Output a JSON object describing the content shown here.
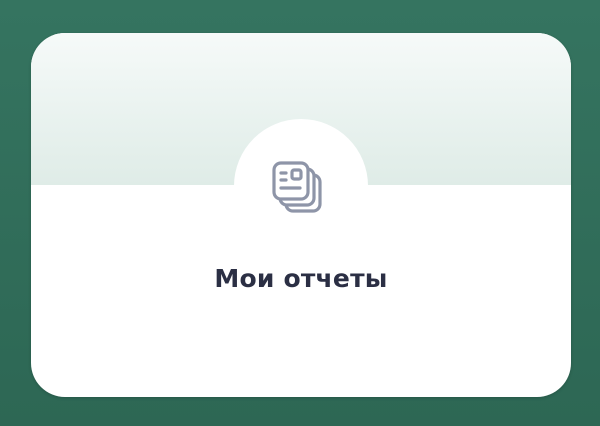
{
  "card": {
    "title": "Мои отчеты",
    "icon": "stacked-documents-icon"
  },
  "colors": {
    "frame_background": "#2f6b58",
    "card_background": "#ffffff",
    "band_tint": "#e4efeb",
    "icon_stroke": "#8e95a8",
    "title_text": "#2b2f44"
  }
}
